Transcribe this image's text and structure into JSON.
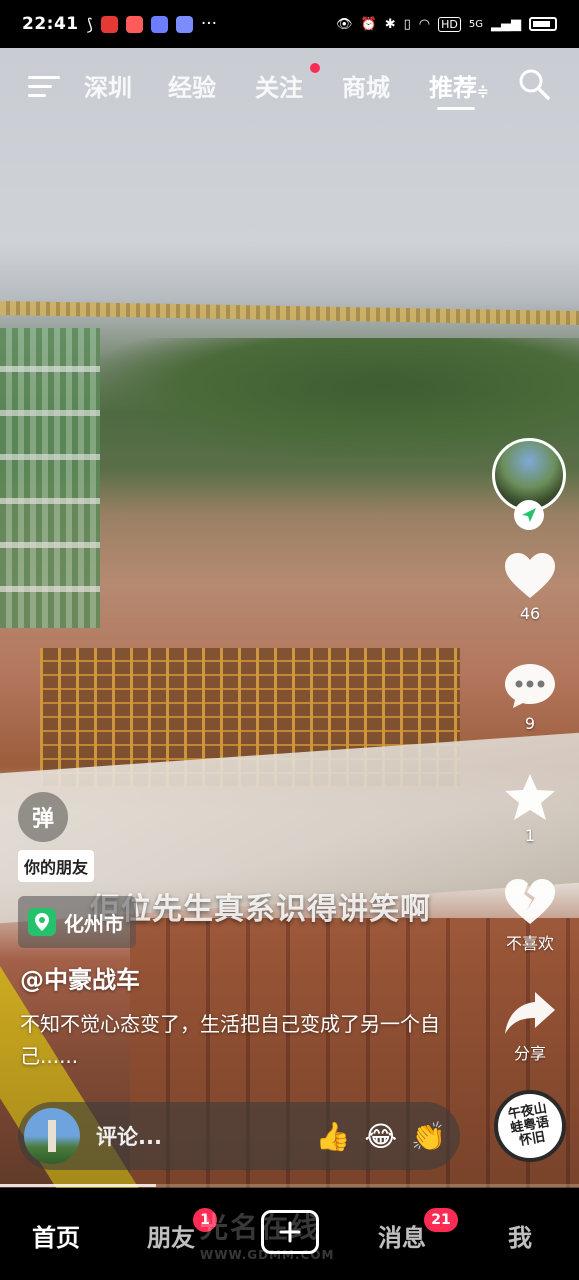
{
  "status_bar": {
    "time": "22:41",
    "right_labels": [
      "HD",
      "5G"
    ],
    "battery_icon": "battery-icon",
    "colors": {
      "app1": "#e53935",
      "app2": "#ff5b5b",
      "app3": "#6c7dff",
      "app4": "#7b8cff"
    }
  },
  "top_tabs": {
    "items": [
      "深圳",
      "经验",
      "关注",
      "商城",
      "推荐"
    ],
    "active": "推荐",
    "active_suffix": "≑"
  },
  "video": {
    "subtitle": "佢位先生真系识得讲笑啊",
    "danmu_label": "弹",
    "friend_tag": "你的朋友",
    "location": "化州市",
    "author": "@中豪战车",
    "description": "不知不觉心态变了，生活把自己变成了另一个自己......"
  },
  "rail": {
    "likes": "46",
    "comments": "9",
    "favorites": "1",
    "dislike_label": "不喜欢",
    "share_label": "分享",
    "music_disc_text": "午夜山蛙粤语怀旧"
  },
  "comment_bar": {
    "placeholder": "评论...",
    "emojis": [
      "👍",
      "😂",
      "👏"
    ]
  },
  "bottom_nav": {
    "home": "首页",
    "friends": "朋友",
    "friends_badge": "1",
    "messages": "消息",
    "messages_badge": "21",
    "me": "我",
    "create_icon": "plus-icon"
  },
  "watermark": {
    "text": "光名在线",
    "url": "WWW.GDMM.COM"
  },
  "accent_colors": {
    "brand_red": "#fe2c55",
    "location_green": "#25c26b"
  }
}
